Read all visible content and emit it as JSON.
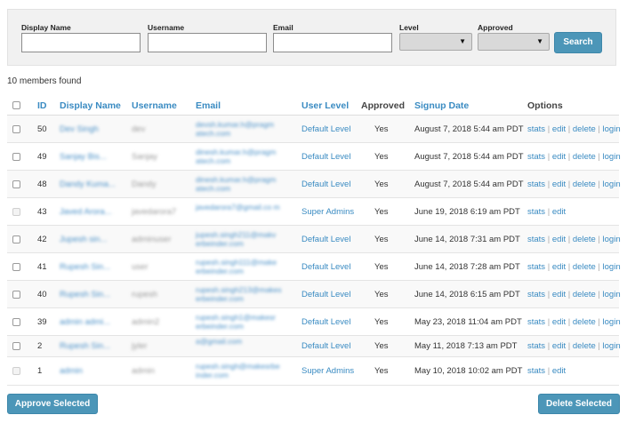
{
  "filters": {
    "display_name_label": "Display Name",
    "username_label": "Username",
    "email_label": "Email",
    "level_label": "Level",
    "approved_label": "Approved",
    "display_name_value": "",
    "username_value": "",
    "email_value": "",
    "level_value": "",
    "approved_value": "",
    "search_label": "Search"
  },
  "count_text": "10 members found",
  "table": {
    "headers": {
      "id": "ID",
      "display_name": "Display Name",
      "username": "Username",
      "email": "Email",
      "user_level": "User Level",
      "approved": "Approved",
      "signup_date": "Signup Date",
      "options": "Options"
    },
    "rows": [
      {
        "id": "50",
        "display_name": "Dev Singh",
        "username": "dev",
        "email": "devsh.kumar.h@pragm atech.com",
        "level": "Default Level",
        "approved": "Yes",
        "date": "August 7, 2018 5:44 am PDT",
        "options": [
          "stats",
          "edit",
          "delete",
          "login"
        ],
        "checkbox_enabled": true
      },
      {
        "id": "49",
        "display_name": "Sanjay Bis...",
        "username": "Sanjay",
        "email": "dinesh.kumar.h@pragm atech.com",
        "level": "Default Level",
        "approved": "Yes",
        "date": "August 7, 2018 5:44 am PDT",
        "options": [
          "stats",
          "edit",
          "delete",
          "login"
        ],
        "checkbox_enabled": true
      },
      {
        "id": "48",
        "display_name": "Dandy Kuma...",
        "username": "Dandy",
        "email": "dinesh.kumar.h@pragm atech.com",
        "level": "Default Level",
        "approved": "Yes",
        "date": "August 7, 2018 5:44 am PDT",
        "options": [
          "stats",
          "edit",
          "delete",
          "login"
        ],
        "checkbox_enabled": true
      },
      {
        "id": "43",
        "display_name": "Javed Arora...",
        "username": "javedarora7",
        "email": "javedarora7@gmail.co m",
        "level": "Super Admins",
        "approved": "Yes",
        "date": "June 19, 2018 6:19 am PDT",
        "options": [
          "stats",
          "edit"
        ],
        "checkbox_enabled": false
      },
      {
        "id": "42",
        "display_name": "Jupesh sin...",
        "username": "adminuser",
        "email": "jupesh.singh211@makv erbeinder.com",
        "level": "Default Level",
        "approved": "Yes",
        "date": "June 14, 2018 7:31 am PDT",
        "options": [
          "stats",
          "edit",
          "delete",
          "login"
        ],
        "checkbox_enabled": true
      },
      {
        "id": "41",
        "display_name": "Rupesh Sin...",
        "username": "user",
        "email": "rupesh.singh111@make erbeinder.com",
        "level": "Default Level",
        "approved": "Yes",
        "date": "June 14, 2018 7:28 am PDT",
        "options": [
          "stats",
          "edit",
          "delete",
          "login"
        ],
        "checkbox_enabled": true
      },
      {
        "id": "40",
        "display_name": "Rupesh Sin...",
        "username": "rupesh",
        "email": "rupesh.singh213@makes erbeinder.com",
        "level": "Default Level",
        "approved": "Yes",
        "date": "June 14, 2018 6:15 am PDT",
        "options": [
          "stats",
          "edit",
          "delete",
          "login"
        ],
        "checkbox_enabled": true
      },
      {
        "id": "39",
        "display_name": "admin admi...",
        "username": "admin2",
        "email": "rupesh.singh1@makesr erbeinder.com",
        "level": "Default Level",
        "approved": "Yes",
        "date": "May 23, 2018 11:04 am PDT",
        "options": [
          "stats",
          "edit",
          "delete",
          "login"
        ],
        "checkbox_enabled": true
      },
      {
        "id": "2",
        "display_name": "Rupesh Sin...",
        "username": "jyler",
        "email": "a@gmail.com",
        "level": "Default Level",
        "approved": "Yes",
        "date": "May 11, 2018 7:13 am PDT",
        "options": [
          "stats",
          "edit",
          "delete",
          "login"
        ],
        "checkbox_enabled": true
      },
      {
        "id": "1",
        "display_name": "admin",
        "username": "admin",
        "email": "rupesh.singh@makesrbe inder.com",
        "level": "Super Admins",
        "approved": "Yes",
        "date": "May 10, 2018 10:02 am PDT",
        "options": [
          "stats",
          "edit"
        ],
        "checkbox_enabled": false
      }
    ]
  },
  "actions": {
    "approve_label": "Approve Selected",
    "delete_label": "Delete Selected"
  },
  "colors": {
    "accent": "#4c96b8",
    "link": "#3a8bc2"
  }
}
